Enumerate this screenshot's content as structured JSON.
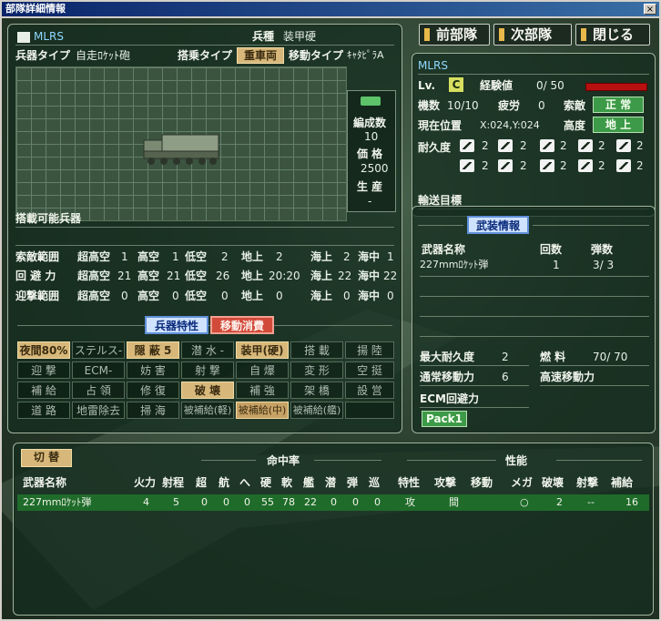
{
  "window": {
    "title": "部隊詳細情報",
    "close": "×"
  },
  "nav": {
    "prev": "前部隊",
    "next": "次部隊",
    "close": "閉じる"
  },
  "unit": {
    "name": "MLRS",
    "type_label": "兵種",
    "type_value": "装甲硬",
    "weapon_type_label": "兵器タイプ",
    "weapon_type_value": "自走ﾛｹｯﾄ砲",
    "boarding_label": "搭乗タイプ",
    "boarding_value": "重車両",
    "move_label": "移動タイプ",
    "move_value": "ｷｬﾀﾋﾟﾗA",
    "formation_label": "編成数",
    "formation_value": "10",
    "price_label": "価 格",
    "price_value": "2500",
    "production_label": "生 産",
    "production_value": "-",
    "loadable_label": "搭載可能兵器"
  },
  "ranges": {
    "rows": [
      {
        "label": "索敵範囲",
        "vals": [
          [
            "超高空",
            "1"
          ],
          [
            "高空",
            "1"
          ],
          [
            "低空",
            "2"
          ],
          [
            "地上",
            "2"
          ],
          [
            "海上",
            "2"
          ],
          [
            "海中",
            "1"
          ]
        ]
      },
      {
        "label": "回 避 力",
        "vals": [
          [
            "超高空",
            "21"
          ],
          [
            "高空",
            "21"
          ],
          [
            "低空",
            "26"
          ],
          [
            "地上",
            "20:20"
          ],
          [
            "海上",
            "22"
          ],
          [
            "海中",
            "22"
          ]
        ]
      },
      {
        "label": "迎撃範囲",
        "vals": [
          [
            "超高空",
            "0"
          ],
          [
            "高空",
            "0"
          ],
          [
            "低空",
            "0"
          ],
          [
            "地上",
            "0"
          ],
          [
            "海上",
            "0"
          ],
          [
            "海中",
            "0"
          ]
        ]
      }
    ]
  },
  "tabs": {
    "features": "兵器特性",
    "move_cost": "移動消費"
  },
  "traits": [
    [
      "夜間80%",
      "ステルス-",
      "隠 蔽 5",
      "潜 水 -",
      "装甲(硬)",
      "搭 載",
      "揚 陸"
    ],
    [
      "迎 撃",
      "ECM-",
      "妨 害",
      "射 撃",
      "自 爆",
      "変 形",
      "空 挺"
    ],
    [
      "補 給",
      "占 領",
      "修 復",
      "破 壊",
      "補 強",
      "架 橋",
      "設 営"
    ],
    [
      "道 路",
      "地雷除去",
      "掃 海",
      "被補給(軽)",
      "被補給(中)",
      "被補給(艦)",
      ""
    ]
  ],
  "status": {
    "name": "MLRS",
    "lv_label": "Lv.",
    "lv_value": "C",
    "exp_label": "経験値",
    "exp_value": "0/ 50",
    "exp_fill": 0.0,
    "units_label": "機数",
    "units_value": "10/10",
    "fatigue_label": "疲労",
    "fatigue_value": "0",
    "search_label": "索敵",
    "search_value": "正 常",
    "pos_label": "現在位置",
    "pos_value": "X:024,Y:024",
    "alt_label": "高度",
    "alt_value": "地 上",
    "dur_label": "耐久度",
    "dur_values": [
      "2",
      "2",
      "2",
      "2",
      "2",
      "2",
      "2",
      "2",
      "2",
      "2"
    ],
    "transport_label": "輸送目標"
  },
  "weapons": {
    "title": "武装情報",
    "hdr_name": "武器名称",
    "hdr_count": "回数",
    "hdr_ammo": "弾数",
    "rows": [
      {
        "name": "227mmﾛｹｯﾄ弾",
        "count": "1",
        "ammo": "3/ 3"
      }
    ],
    "max_dur_label": "最大耐久度",
    "max_dur_value": "2",
    "fuel_label": "燃 料",
    "fuel_value": "70/ 70",
    "normal_move_label": "通常移動力",
    "normal_move_value": "6",
    "fast_move_label": "高速移動力",
    "ecm_label": "ECM回避力",
    "pack": "Pack1"
  },
  "bottom": {
    "switch": "切 替",
    "hit_rate": "命中率",
    "performance": "性能",
    "headers": [
      "武器名称",
      "火力",
      "射程",
      "超",
      "航",
      "へ",
      "硬",
      "軟",
      "艦",
      "潜",
      "弾",
      "巡",
      "特性",
      "攻撃",
      "移動",
      "メガ",
      "破壊",
      "射撃",
      "補給"
    ],
    "row": [
      "227mmﾛｹｯﾄ弾",
      "4",
      "5",
      "0",
      "0",
      "0",
      "55",
      "78",
      "22",
      "0",
      "0",
      "0",
      "攻",
      "間",
      "",
      "○",
      "2",
      "--",
      "16"
    ]
  }
}
